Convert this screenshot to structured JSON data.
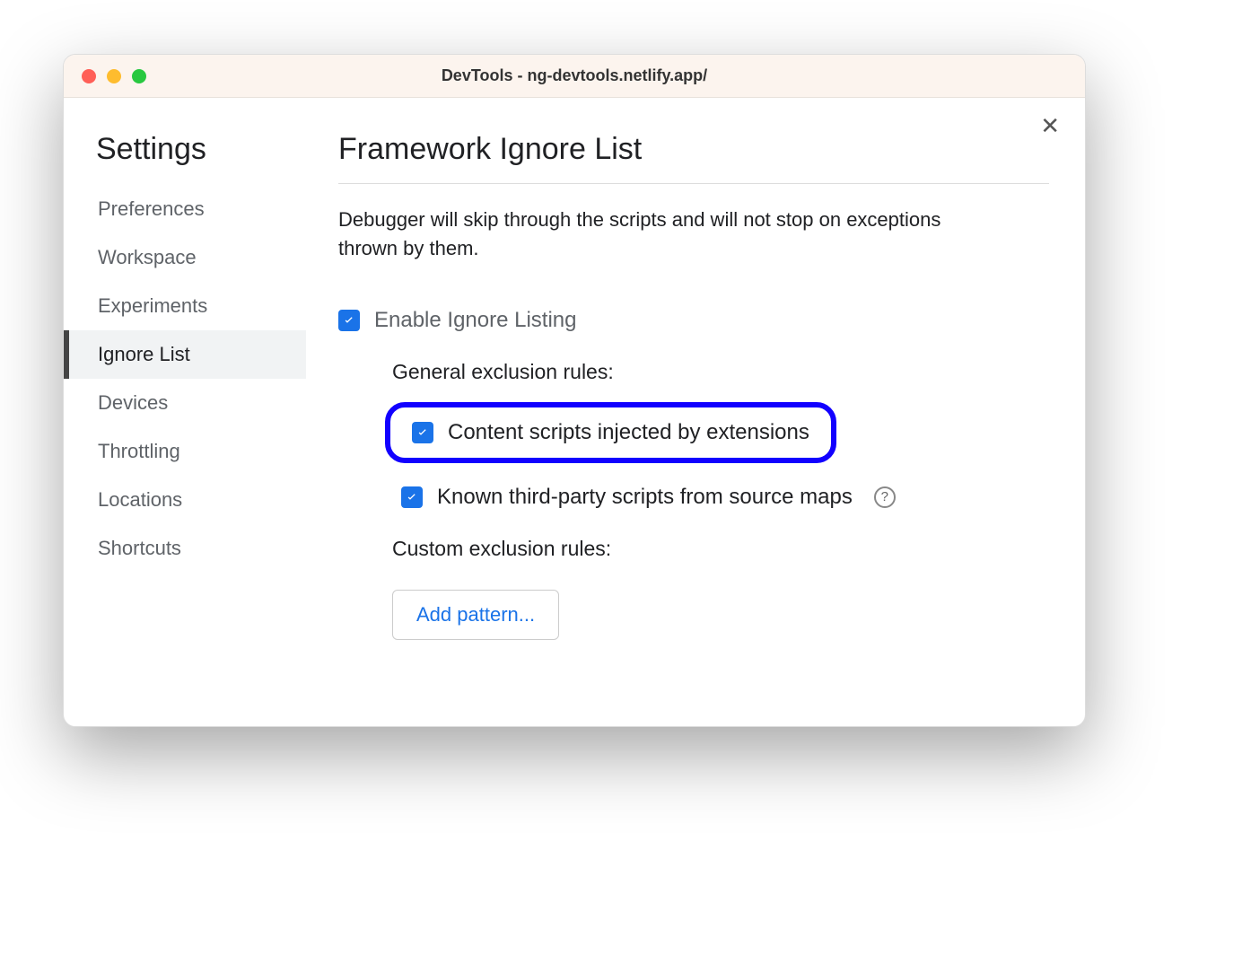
{
  "window": {
    "title": "DevTools - ng-devtools.netlify.app/"
  },
  "sidebar": {
    "title": "Settings",
    "items": [
      {
        "label": "Preferences",
        "active": false
      },
      {
        "label": "Workspace",
        "active": false
      },
      {
        "label": "Experiments",
        "active": false
      },
      {
        "label": "Ignore List",
        "active": true
      },
      {
        "label": "Devices",
        "active": false
      },
      {
        "label": "Throttling",
        "active": false
      },
      {
        "label": "Locations",
        "active": false
      },
      {
        "label": "Shortcuts",
        "active": false
      }
    ]
  },
  "content": {
    "heading": "Framework Ignore List",
    "description": "Debugger will skip through the scripts and will not stop on exceptions thrown by them.",
    "enable_label": "Enable Ignore Listing",
    "enable_checked": true,
    "general_section_title": "General exclusion rules:",
    "rules": [
      {
        "label": "Content scripts injected by extensions",
        "checked": true,
        "highlighted": true,
        "help": false
      },
      {
        "label": "Known third-party scripts from source maps",
        "checked": true,
        "highlighted": false,
        "help": true
      }
    ],
    "custom_section_title": "Custom exclusion rules:",
    "add_pattern_label": "Add pattern..."
  }
}
